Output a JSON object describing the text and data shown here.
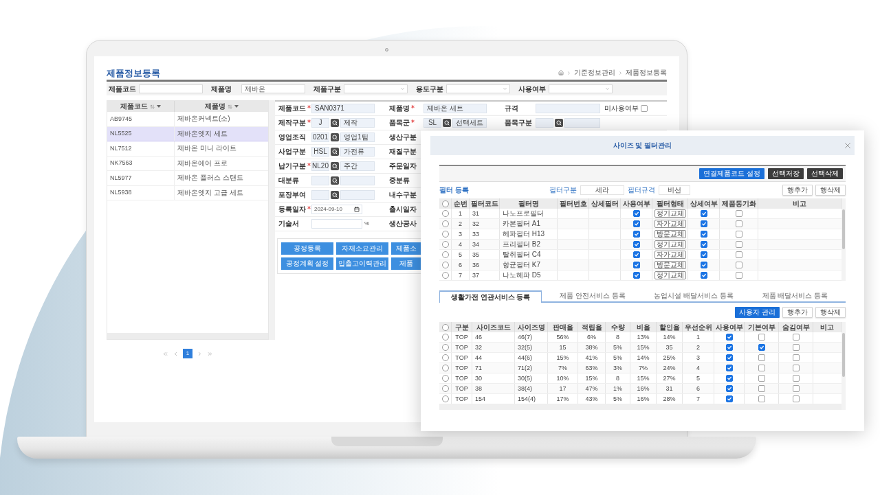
{
  "page": {
    "title": "제품정보등록",
    "breadcrumb": [
      "기준정보관리",
      "제품정보등록"
    ]
  },
  "search": [
    {
      "label": "제품코드",
      "kind": "text"
    },
    {
      "label": "제품명",
      "kind": "text",
      "value": "제바온"
    },
    {
      "label": "제품구분",
      "kind": "select"
    },
    {
      "label": "용도구분",
      "kind": "select"
    },
    {
      "label": "사용여부",
      "kind": "select"
    }
  ],
  "product_grid": {
    "columns": [
      "제품코드",
      "제품명"
    ],
    "rows": [
      {
        "code": "AB9745",
        "name": "제바온커넥트(소)",
        "selected": false
      },
      {
        "code": "NL5525",
        "name": "제바온엣지 세트",
        "selected": true
      },
      {
        "code": "NL7512",
        "name": "제바온 미니 라이트",
        "selected": false
      },
      {
        "code": "NK7563",
        "name": "제바온에어 프로",
        "selected": false
      },
      {
        "code": "NL5977",
        "name": "제바온 플러스 스탠드",
        "selected": false
      },
      {
        "code": "NL5938",
        "name": "제바온엣지 고급 세트",
        "selected": false
      }
    ]
  },
  "pagination": [
    {
      "label": "1",
      "selected": true
    }
  ],
  "form": [
    [
      {
        "label": "제품코드",
        "required": true,
        "kind": "text",
        "value": "SAN0371"
      },
      {
        "label": "제품명",
        "required": true,
        "kind": "text",
        "value": "제바온 세트"
      },
      {
        "label": "규격",
        "required": false,
        "kind": "text"
      },
      {
        "label": "미사용여부",
        "required": false,
        "kind": "checkbox",
        "checked": false
      }
    ],
    [
      {
        "label": "제작구분",
        "required": true,
        "kind": "lookup",
        "code": "J",
        "value": "제작"
      },
      {
        "label": "품목군",
        "required": true,
        "kind": "lookup",
        "code": "SL",
        "value": "선택세트"
      },
      {
        "label": "품목구분",
        "required": false,
        "kind": "lookup"
      }
    ],
    [
      {
        "label": "영업조직",
        "required": false,
        "kind": "lookup",
        "code": "0201",
        "value": "영업1팀"
      },
      {
        "label": "생산구분",
        "required": false,
        "kind": "label"
      }
    ],
    [
      {
        "label": "사업구분",
        "required": false,
        "kind": "lookup",
        "code": "HSL",
        "value": "가전류"
      },
      {
        "label": "재질구분",
        "required": false,
        "kind": "label"
      }
    ],
    [
      {
        "label": "납기구분",
        "required": true,
        "kind": "lookup",
        "code": "NL20",
        "value": "주간"
      },
      {
        "label": "주문일자",
        "required": false,
        "kind": "label"
      }
    ],
    [
      {
        "label": "대분류",
        "required": false,
        "kind": "lookup"
      },
      {
        "label": "중분류",
        "required": false,
        "kind": "label"
      }
    ],
    [
      {
        "label": "포장부여",
        "required": false,
        "kind": "lookup"
      },
      {
        "label": "내수구분",
        "required": false,
        "kind": "label"
      }
    ],
    [
      {
        "label": "등록일자",
        "required": true,
        "kind": "date",
        "value": "2024-09-10"
      },
      {
        "label": "출시일자",
        "required": false,
        "kind": "label"
      }
    ],
    [
      {
        "label": "기술서",
        "required": false,
        "kind": "number",
        "unit": "%"
      },
      {
        "label": "생산공사",
        "required": false,
        "kind": "label"
      }
    ]
  ],
  "actions": [
    "공정등록",
    "자재소요관리",
    "제품소",
    "공정계획 설정",
    "입출고이력관리",
    "제품"
  ],
  "modal": {
    "title": "사이즈 및 필터관리",
    "toolbar": [
      {
        "label": "연결제품코드 설정",
        "kind": "primary"
      },
      {
        "label": "선택저장",
        "kind": "dark"
      },
      {
        "label": "선택삭제",
        "kind": "dark"
      }
    ],
    "filter_section": {
      "title": "필터 등록",
      "filters": [
        {
          "label": "필터구분",
          "value": "세라"
        },
        {
          "label": "필터규격",
          "value": "비선"
        }
      ],
      "buttons": [
        {
          "label": "행추가",
          "kind": "plain"
        },
        {
          "label": "행삭제",
          "kind": "plain"
        }
      ]
    },
    "filter_table": {
      "all_checked": false,
      "columns": [
        "순번",
        "필터코드",
        "필터명",
        "필터번호",
        "상세필터",
        "사용여부",
        "필터형태",
        "상세여부",
        "제품동기화",
        "비고"
      ],
      "rows": [
        {
          "checked": false,
          "no": "1",
          "code": "31",
          "name": "나노프로필터",
          "in_use": true,
          "type": "정기교체",
          "detail": true,
          "sync": false
        },
        {
          "checked": false,
          "no": "2",
          "code": "32",
          "name": "카본필터 A1",
          "in_use": true,
          "type": "자가교체",
          "detail": true,
          "sync": false
        },
        {
          "checked": false,
          "no": "3",
          "code": "33",
          "name": "헤파필터 H13",
          "in_use": true,
          "type": "방문교체",
          "detail": true,
          "sync": false
        },
        {
          "checked": false,
          "no": "4",
          "code": "34",
          "name": "프리필터 B2",
          "in_use": true,
          "type": "정기교체",
          "detail": true,
          "sync": false
        },
        {
          "checked": false,
          "no": "5",
          "code": "35",
          "name": "탈취필터 C4",
          "in_use": true,
          "type": "자가교체",
          "detail": true,
          "sync": false
        },
        {
          "checked": false,
          "no": "6",
          "code": "36",
          "name": "항균필터 K7",
          "in_use": true,
          "type": "방문교체",
          "detail": true,
          "sync": false
        },
        {
          "checked": false,
          "no": "7",
          "code": "37",
          "name": "나노헤파 D5",
          "in_use": true,
          "type": "정기교체",
          "detail": true,
          "sync": false
        }
      ]
    },
    "tabs": [
      {
        "label": "생활가전 연관서비스 등록",
        "selected": true
      },
      {
        "label": "제품 안전서비스 등록",
        "selected": false
      },
      {
        "label": "농업시설 배달서비스 등록",
        "selected": false
      },
      {
        "label": "제품 배달서비스 등록",
        "selected": false
      }
    ],
    "tab_buttons": [
      {
        "label": "사용자 관리",
        "kind": "primary"
      },
      {
        "label": "행추가",
        "kind": "plain"
      },
      {
        "label": "행삭제",
        "kind": "plain"
      }
    ],
    "size_table": {
      "all_checked": false,
      "columns": [
        "구분",
        "사이즈코드",
        "사이즈명",
        "판매율",
        "적립율",
        "수량",
        "비율",
        "할인율",
        "우선순위",
        "사용여부",
        "기본여부",
        "숨김여부",
        "비고"
      ],
      "rows": [
        {
          "checked": false,
          "group": "TOP",
          "code": "46",
          "name": "46(7)",
          "sales": "56%",
          "reserve": "6%",
          "qty": "8",
          "ratio": "13%",
          "discount": "14%",
          "priority": "1",
          "in_use": true,
          "default": false,
          "hidden": false
        },
        {
          "checked": false,
          "group": "TOP",
          "code": "32",
          "name": "32(5)",
          "sales": "15",
          "reserve": "38%",
          "qty": "5%",
          "ratio": "15%",
          "discount": "35",
          "priority": "2",
          "in_use": true,
          "default": true,
          "hidden": false
        },
        {
          "checked": false,
          "group": "TOP",
          "code": "44",
          "name": "44(6)",
          "sales": "15%",
          "reserve": "41%",
          "qty": "5%",
          "ratio": "14%",
          "discount": "25%",
          "priority": "3",
          "in_use": true,
          "default": false,
          "hidden": false
        },
        {
          "checked": false,
          "group": "TOP",
          "code": "71",
          "name": "71(2)",
          "sales": "7%",
          "reserve": "63%",
          "qty": "3%",
          "ratio": "7%",
          "discount": "24%",
          "priority": "4",
          "in_use": true,
          "default": false,
          "hidden": false
        },
        {
          "checked": false,
          "group": "TOP",
          "code": "30",
          "name": "30(5)",
          "sales": "10%",
          "reserve": "15%",
          "qty": "8",
          "ratio": "15%",
          "discount": "27%",
          "priority": "5",
          "in_use": true,
          "default": false,
          "hidden": false
        },
        {
          "checked": false,
          "group": "TOP",
          "code": "38",
          "name": "38(4)",
          "sales": "17",
          "reserve": "47%",
          "qty": "1%",
          "ratio": "16%",
          "discount": "31",
          "priority": "6",
          "in_use": true,
          "default": false,
          "hidden": false
        },
        {
          "checked": false,
          "group": "TOP",
          "code": "154",
          "name": "154(4)",
          "sales": "17%",
          "reserve": "43%",
          "qty": "5%",
          "ratio": "16%",
          "discount": "28%",
          "priority": "7",
          "in_use": true,
          "default": false,
          "hidden": false
        }
      ]
    }
  }
}
